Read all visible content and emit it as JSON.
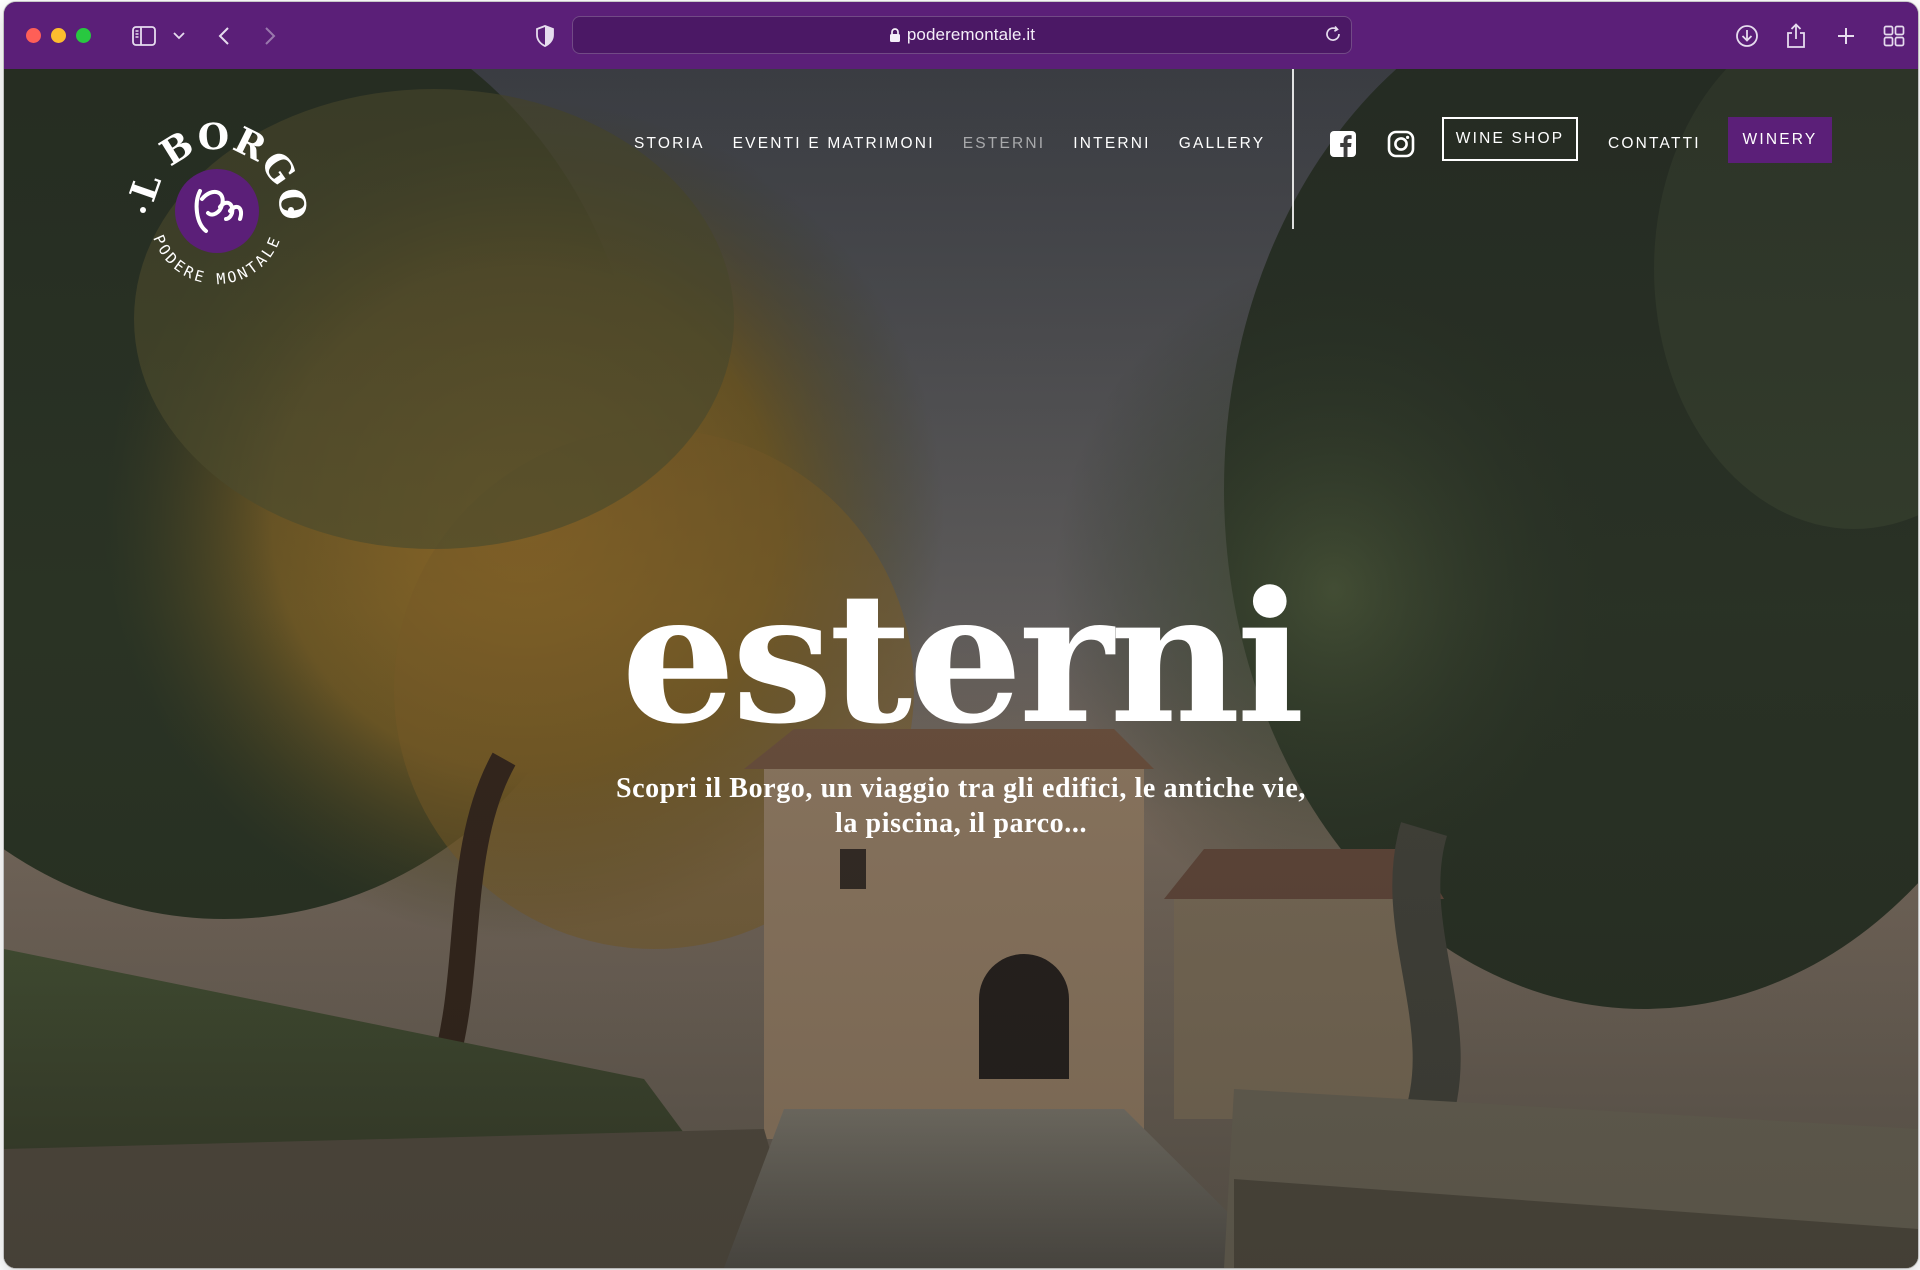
{
  "browser": {
    "url": "poderemontale.it"
  },
  "site": {
    "logo": {
      "top_text": "IL BORGO",
      "bottom_text": "PODERE MONTALE"
    },
    "nav": {
      "items": [
        "STORIA",
        "EVENTI E MATRIMONI",
        "ESTERNI",
        "INTERNI",
        "GALLERY"
      ],
      "active": "ESTERNI",
      "wine_shop": "WINE SHOP",
      "contatti": "CONTATTI",
      "winery": "WINERY"
    },
    "hero": {
      "title": "esterni",
      "subtitle": "Scopri il Borgo, un viaggio tra gli edifici, le antiche vie, la piscina, il parco..."
    },
    "colors": {
      "brand_purple": "#5b1f78",
      "text": "#ffffff"
    },
    "icons": [
      "facebook-icon",
      "instagram-icon",
      "lock-icon",
      "reload-icon",
      "sidebar-icon",
      "back-icon",
      "forward-icon",
      "shield-icon",
      "download-icon",
      "share-icon",
      "new-tab-icon",
      "tabs-overview-icon"
    ]
  }
}
